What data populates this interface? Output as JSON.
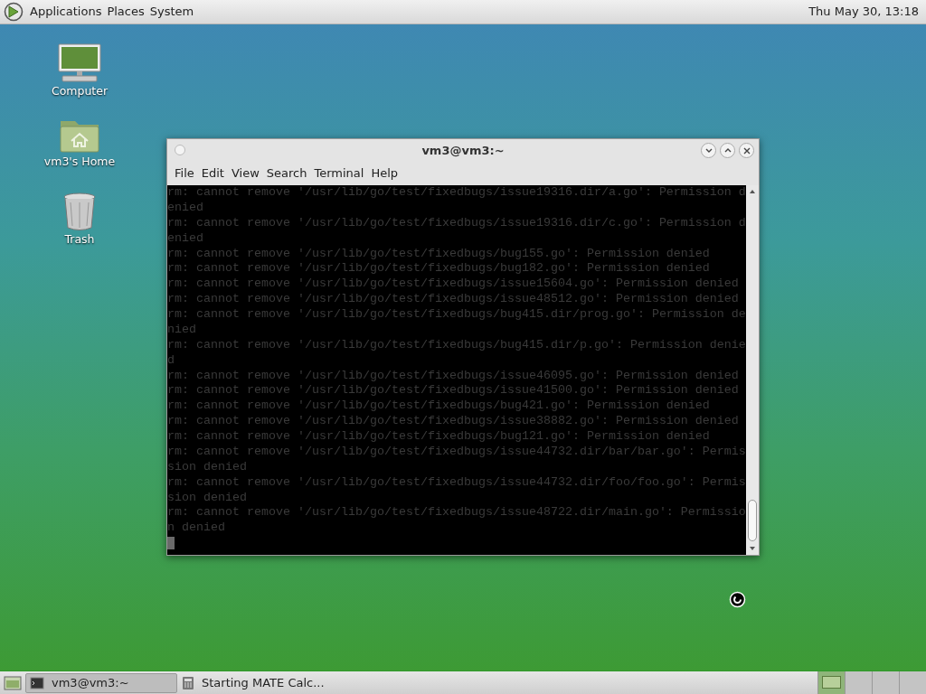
{
  "top_panel": {
    "menus": [
      {
        "label": "Applications"
      },
      {
        "label": "Places"
      },
      {
        "label": "System"
      }
    ],
    "clock": "Thu May 30, 13:18"
  },
  "desktop_icons": [
    {
      "kind": "computer",
      "label": "Computer"
    },
    {
      "kind": "home",
      "label": "vm3's Home"
    },
    {
      "kind": "trash",
      "label": "Trash"
    }
  ],
  "window": {
    "title": "vm3@vm3:~",
    "menu": [
      "File",
      "Edit",
      "View",
      "Search",
      "Terminal",
      "Help"
    ],
    "terminal_lines": [
      "rm: cannot remove '/usr/lib/go/test/fixedbugs/issue19316.dir/a.go': Permission d",
      "enied",
      "rm: cannot remove '/usr/lib/go/test/fixedbugs/issue19316.dir/c.go': Permission d",
      "enied",
      "rm: cannot remove '/usr/lib/go/test/fixedbugs/bug155.go': Permission denied",
      "rm: cannot remove '/usr/lib/go/test/fixedbugs/bug182.go': Permission denied",
      "rm: cannot remove '/usr/lib/go/test/fixedbugs/issue15604.go': Permission denied",
      "rm: cannot remove '/usr/lib/go/test/fixedbugs/issue48512.go': Permission denied",
      "rm: cannot remove '/usr/lib/go/test/fixedbugs/bug415.dir/prog.go': Permission de",
      "nied",
      "rm: cannot remove '/usr/lib/go/test/fixedbugs/bug415.dir/p.go': Permission denie",
      "d",
      "rm: cannot remove '/usr/lib/go/test/fixedbugs/issue46095.go': Permission denied",
      "rm: cannot remove '/usr/lib/go/test/fixedbugs/issue41500.go': Permission denied",
      "rm: cannot remove '/usr/lib/go/test/fixedbugs/bug421.go': Permission denied",
      "rm: cannot remove '/usr/lib/go/test/fixedbugs/issue38882.go': Permission denied",
      "rm: cannot remove '/usr/lib/go/test/fixedbugs/bug121.go': Permission denied",
      "rm: cannot remove '/usr/lib/go/test/fixedbugs/issue44732.dir/bar/bar.go': Permis",
      "sion denied",
      "rm: cannot remove '/usr/lib/go/test/fixedbugs/issue44732.dir/foo/foo.go': Permis",
      "sion denied",
      "rm: cannot remove '/usr/lib/go/test/fixedbugs/issue48722.dir/main.go': Permissio",
      "n denied"
    ]
  },
  "taskbar": {
    "tasks": [
      {
        "kind": "terminal",
        "label": "vm3@vm3:~",
        "selected": true
      },
      {
        "kind": "calculator",
        "label": "Starting MATE Calc...",
        "selected": false
      }
    ],
    "workspaces": [
      {
        "selected": true
      },
      {
        "selected": false
      },
      {
        "selected": false
      },
      {
        "selected": false
      }
    ]
  }
}
